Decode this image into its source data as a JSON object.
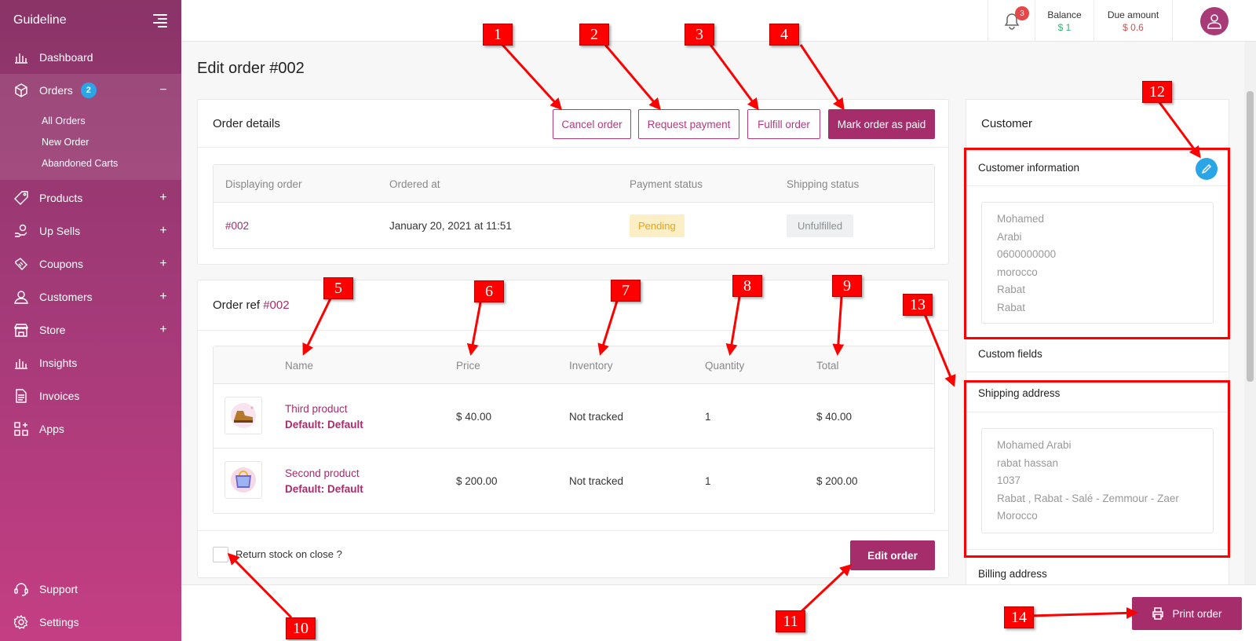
{
  "sidebar": {
    "brand": "Guideline",
    "items": [
      {
        "label": "Dashboard"
      },
      {
        "label": "Orders",
        "badge": "2",
        "toggle": "−"
      },
      {
        "label": "Products",
        "toggle": "+"
      },
      {
        "label": "Up Sells",
        "toggle": "+"
      },
      {
        "label": "Coupons",
        "toggle": "+"
      },
      {
        "label": "Customers",
        "toggle": "+"
      },
      {
        "label": "Store",
        "toggle": "+"
      },
      {
        "label": "Insights"
      },
      {
        "label": "Invoices"
      },
      {
        "label": "Apps"
      }
    ],
    "orders_sub": [
      "All Orders",
      "New Order",
      "Abandoned Carts"
    ],
    "bottom": [
      {
        "label": "Support"
      },
      {
        "label": "Settings"
      }
    ]
  },
  "topbar": {
    "notifications": "3",
    "balance_label": "Balance",
    "balance_value": "$ 1",
    "due_label": "Due amount",
    "due_value": "$ 0.6"
  },
  "page": {
    "title": "Edit order #002"
  },
  "order_details": {
    "title": "Order details",
    "actions": {
      "cancel": "Cancel order",
      "request_payment": "Request payment",
      "fulfill": "Fulfill order",
      "mark_paid": "Mark order as paid"
    },
    "columns": [
      "Displaying order",
      "Ordered at",
      "Payment status",
      "Shipping status"
    ],
    "row": {
      "order": "#002",
      "ordered_at": "January 20, 2021 at 11:51",
      "payment_status": "Pending",
      "shipping_status": "Unfulfilled"
    }
  },
  "order_ref": {
    "title_prefix": "Order ref",
    "title_ref": "#002",
    "columns": [
      "Name",
      "Price",
      "Inventory",
      "Quantity",
      "Total"
    ],
    "items": [
      {
        "name": "Third product",
        "variant": "Default: Default",
        "price": "$ 40.00",
        "inventory": "Not tracked",
        "quantity": "1",
        "total": "$ 40.00"
      },
      {
        "name": "Second product",
        "variant": "Default: Default",
        "price": "$ 200.00",
        "inventory": "Not tracked",
        "quantity": "1",
        "total": "$ 200.00"
      }
    ],
    "return_stock_label": "Return stock on close ?",
    "edit_button": "Edit order"
  },
  "customer": {
    "title": "Customer",
    "info_title": "Customer information",
    "info_lines": [
      "Mohamed",
      "Arabi",
      "0600000000",
      "morocco",
      "Rabat",
      "Rabat"
    ],
    "custom_fields": "Custom fields",
    "shipping_title": "Shipping address",
    "shipping_lines": [
      "Mohamed Arabi",
      "rabat hassan",
      "1037",
      "Rabat , Rabat - Salé - Zemmour - Zaer",
      "Morocco"
    ],
    "billing_title": "Billing address"
  },
  "footer": {
    "print_button": "Print order"
  },
  "annotations": [
    "1",
    "2",
    "3",
    "4",
    "5",
    "6",
    "7",
    "8",
    "9",
    "10",
    "11",
    "12",
    "13",
    "14"
  ],
  "colors": {
    "brand": "#a52d6b",
    "accent_blue": "#2aa5e8",
    "annotation": "#ff0000"
  }
}
